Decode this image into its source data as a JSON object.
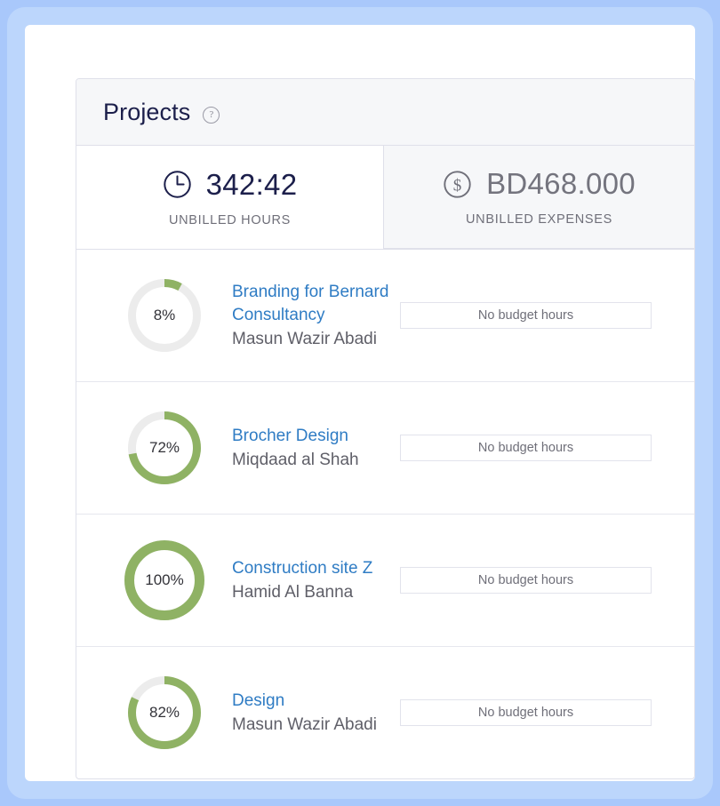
{
  "theme": {
    "accent_blue": "#2f7cc4",
    "progress_green": "#8fb264",
    "progress_track": "#ececec",
    "navy": "#1c1f4b",
    "muted_gray": "#6f6f79",
    "panel_gray": "#f6f7f9",
    "border_gray": "#dfe0ea",
    "backdrop_blue": "#a9c8fb"
  },
  "card": {
    "title": "Projects",
    "help_icon": "question-circle-icon",
    "help_label": "?"
  },
  "stats": [
    {
      "icon": "clock-icon",
      "value": "342:42",
      "label": "UNBILLED HOURS",
      "active": true
    },
    {
      "icon": "dollar-circle-icon",
      "value": "BD468.000",
      "label": "UNBILLED EXPENSES",
      "active": false
    }
  ],
  "projects": [
    {
      "percent": 8,
      "percent_label": "8%",
      "name": "Branding for Bernard Consultancy",
      "client": "Masun Wazir Abadi",
      "budget_label": "No budget hours"
    },
    {
      "percent": 72,
      "percent_label": "72%",
      "name": "Brocher Design",
      "client": "Miqdaad al Shah",
      "budget_label": "No budget hours"
    },
    {
      "percent": 100,
      "percent_label": "100%",
      "name": "Construction site Z",
      "client": "Hamid Al Banna",
      "budget_label": "No budget hours"
    },
    {
      "percent": 82,
      "percent_label": "82%",
      "name": "Design",
      "client": "Masun Wazir Abadi",
      "budget_label": "No budget hours"
    }
  ]
}
